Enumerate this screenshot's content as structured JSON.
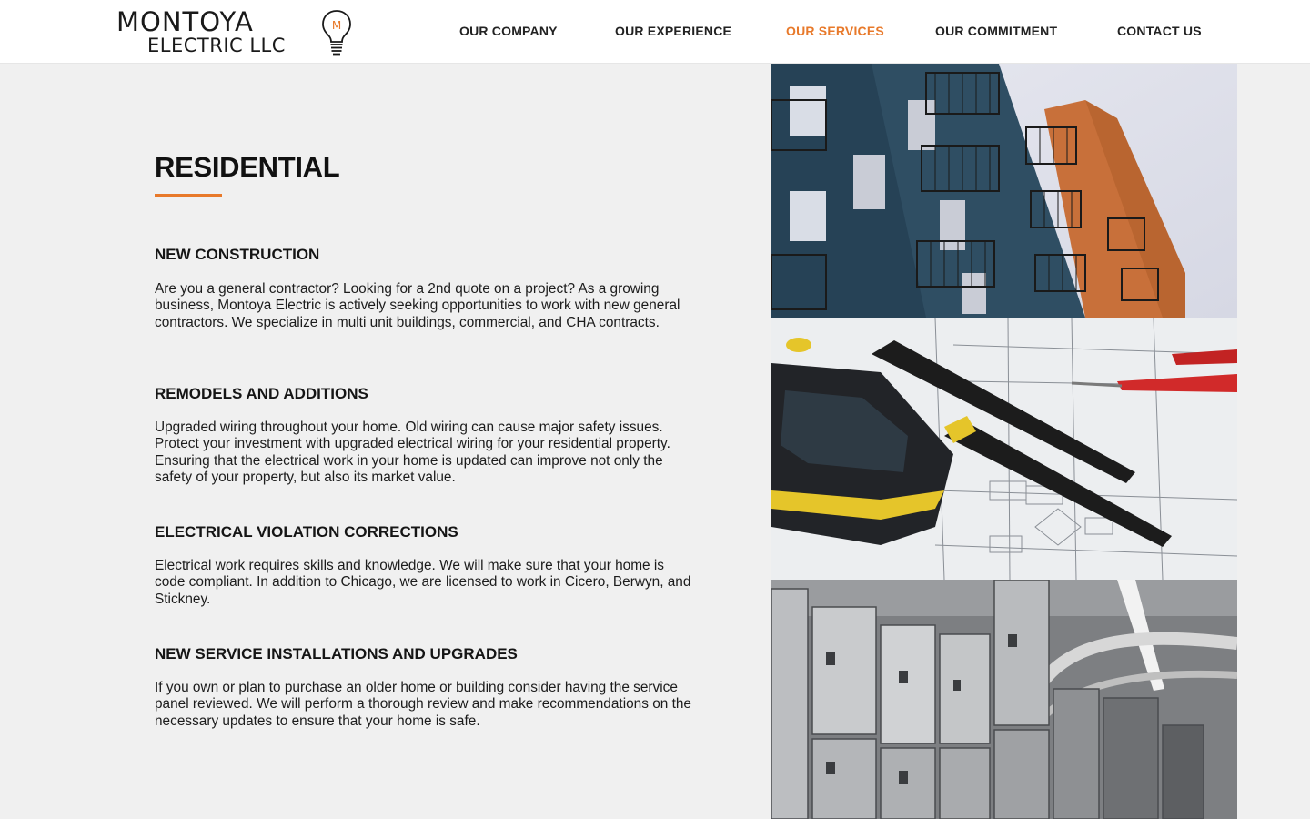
{
  "header": {
    "logo": {
      "line1": "MONTOYA",
      "line2": "ELECTRIC LLC",
      "bulb_letter": "M",
      "bulb_icon": "lightbulb-icon"
    },
    "nav": [
      {
        "label": "OUR COMPANY",
        "active": false
      },
      {
        "label": "OUR EXPERIENCE",
        "active": false
      },
      {
        "label": "OUR SERVICES",
        "active": true
      },
      {
        "label": "OUR COMMITMENT",
        "active": false
      },
      {
        "label": "CONTACT US",
        "active": false
      }
    ]
  },
  "main": {
    "title": "RESIDENTIAL",
    "sections": [
      {
        "heading": "NEW CONSTRUCTION",
        "body": "Are you a general contractor? Looking for a 2nd quote on a project? As a growing business, Montoya Electric is actively seeking opportunities to work with new general contractors. We specialize in multi unit buildings, commercial, and CHA contracts."
      },
      {
        "heading": "REMODELS AND ADDITIONS",
        "body": "Upgraded wiring throughout your home. Old wiring can cause major safety issues. Protect your investment with upgraded electrical wiring for your residential property. Ensuring that the electrical work in your home is updated can improve not only the safety of your property, but also its market value."
      },
      {
        "heading": "ELECTRICAL VIOLATION CORRECTIONS",
        "body": "Electrical work requires skills and knowledge. We will make sure that your home is code compliant. In addition to Chicago, we are licensed to work in Cicero, Berwyn, and Stickney."
      },
      {
        "heading": "NEW SERVICE INSTALLATIONS AND UPGRADES",
        "body": "If you own or plan to purchase an older home or building consider having the service panel reviewed. We will perform a thorough review and make recommendations on the necessary updates to ensure that your home is safe."
      }
    ]
  },
  "images": [
    {
      "subject": "apartment-building-balconies-photo"
    },
    {
      "subject": "voltage-tester-on-blueprint-photo"
    },
    {
      "subject": "electrical-panels-room-photo"
    }
  ],
  "colors": {
    "accent": "#e8792a",
    "page_background": "#f0f0f0",
    "header_background": "#ffffff",
    "text": "#111111"
  }
}
